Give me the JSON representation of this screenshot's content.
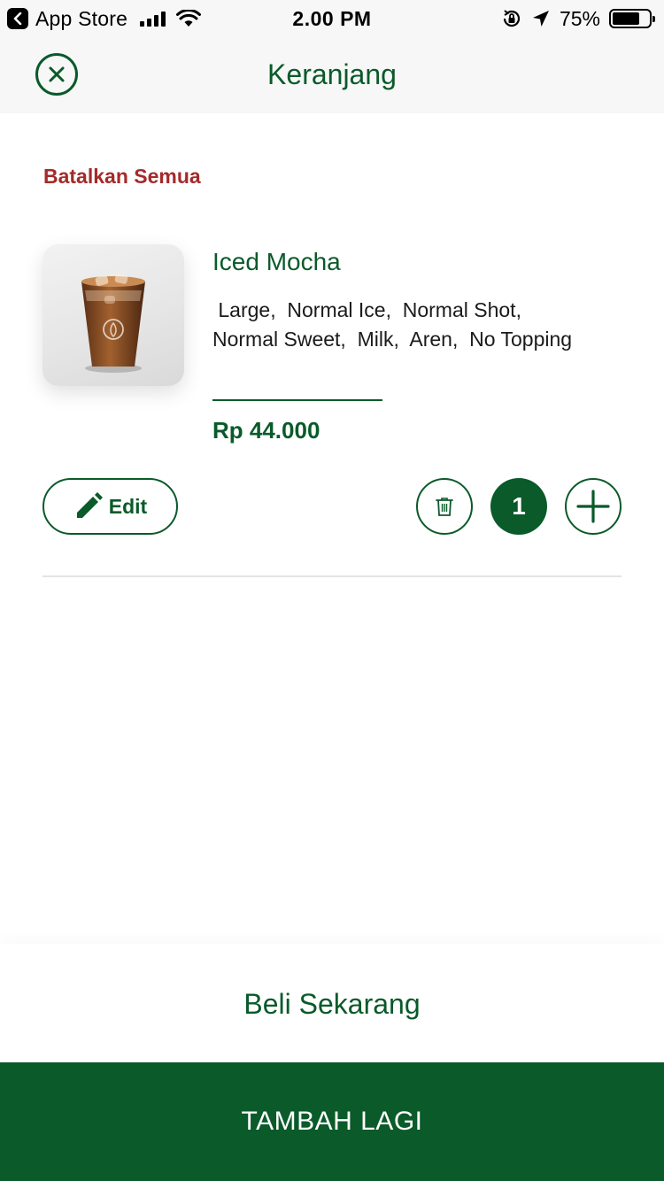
{
  "status_bar": {
    "back_app": "App Store",
    "time": "2.00 PM",
    "battery_percent": "75%",
    "battery_level": 0.75
  },
  "header": {
    "title": "Keranjang",
    "close_icon": "close-circle-icon"
  },
  "cart": {
    "cancel_all_label": "Batalkan Semua",
    "items": [
      {
        "name": "Iced Mocha",
        "options_line1": " Large,  Normal Ice,  Normal Shot,",
        "options_line2": "Normal Sweet,  Milk,  Aren,  No Topping",
        "price": "Rp 44.000",
        "quantity": "1",
        "edit_label": "Edit",
        "image_brand": "fore"
      }
    ]
  },
  "footer": {
    "buy_now_label": "Beli Sekarang",
    "add_more_label": "TAMBAH LAGI"
  },
  "colors": {
    "primary_green": "#0a5a2a",
    "danger_red": "#a52a2a",
    "header_bg": "#f7f7f7"
  }
}
